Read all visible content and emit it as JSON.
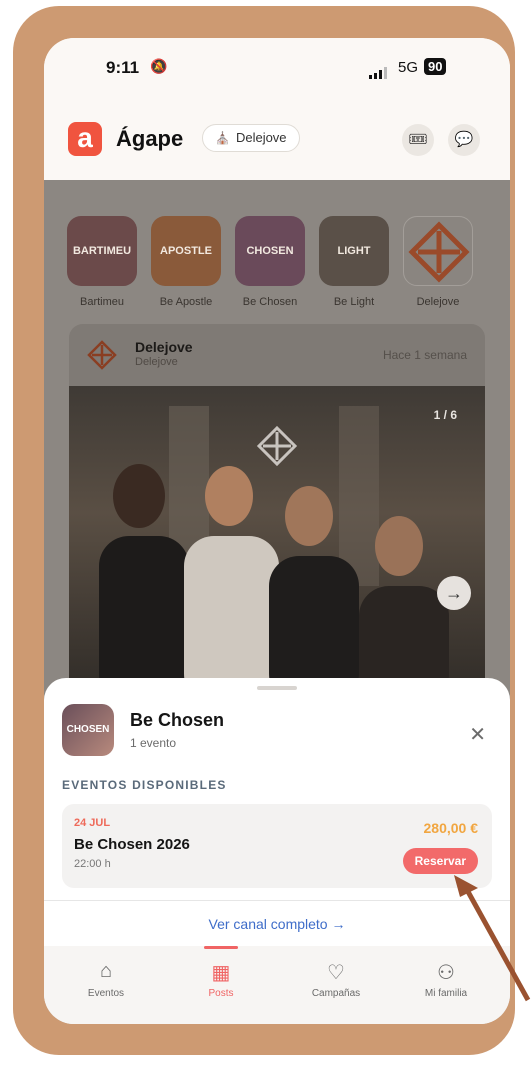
{
  "status": {
    "time": "9:11",
    "network": "5G",
    "battery": "90"
  },
  "header": {
    "logo_letter": "a",
    "app_name": "Ágape",
    "chip_label": "Delejove"
  },
  "stories": [
    {
      "label": "Bartimeu",
      "thumb_text": "BARTIMEU",
      "color": "#6b4a4a"
    },
    {
      "label": "Be Apostle",
      "thumb_text": "APOSTLE",
      "color": "#8a5a3a"
    },
    {
      "label": "Be Chosen",
      "thumb_text": "CHOSEN",
      "color": "#6a4a5a"
    },
    {
      "label": "Be Light",
      "thumb_text": "LIGHT",
      "color": "#5a5048"
    },
    {
      "label": "Delejove",
      "thumb_text": "",
      "color": "#8c8782"
    }
  ],
  "post": {
    "author": "Delejove",
    "subtitle": "Delejove",
    "time_ago": "Hace 1 semana",
    "counter": "1 / 6"
  },
  "sheet": {
    "title": "Be Chosen",
    "subtitle": "1 evento",
    "avatar_text": "CHOSEN",
    "section_label": "EVENTOS DISPONIBLES",
    "event": {
      "date": "24 JUL",
      "name": "Be Chosen 2026",
      "time": "22:00 h",
      "price": "280,00 €",
      "button": "Reservar"
    },
    "link": "Ver canal completo →"
  },
  "tabs": [
    {
      "label": "Eventos",
      "icon": "home-icon"
    },
    {
      "label": "Posts",
      "icon": "posts-icon"
    },
    {
      "label": "Campañas",
      "icon": "heart-icon"
    },
    {
      "label": "Mi familia",
      "icon": "family-icon"
    }
  ],
  "accent": "#f06464"
}
